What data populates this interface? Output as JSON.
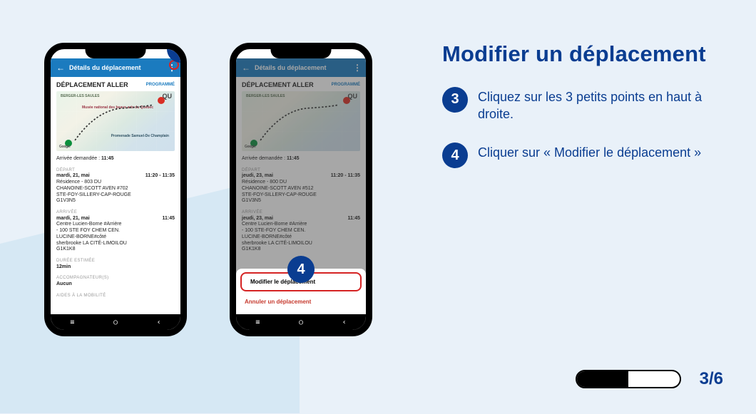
{
  "page": {
    "title": "Modifier un déplacement",
    "instructions": [
      {
        "num": "3",
        "text": "Cliquez sur les 3 petits points en haut à droite."
      },
      {
        "num": "4",
        "text": "Cliquer sur « Modifier le déplacement »"
      }
    ],
    "progress": {
      "percent": 50,
      "page_indicator": "3/6"
    }
  },
  "phone1": {
    "header": {
      "back": "←",
      "title": "Détails du déplacement",
      "menu": "⋮"
    },
    "section": "DÉPLACEMENT ALLER",
    "status": "PROGRAMMÉ",
    "map": {
      "label_ul": "BERGER-LES\nSAULES",
      "label_ur": "QU",
      "poi1": "Musée national des\nbeaux-arts du Québec",
      "poi2": "Promenade\nSamuel-De\nChamplain",
      "google": "Google"
    },
    "arrival_requested_label": "Arrivée demandée :",
    "arrival_requested_value": "11:45",
    "depart": {
      "label": "DÉPART",
      "day": "mardi, 21, mai",
      "time": "11:20 - 11:35",
      "lines": [
        "Résidence - 803 DU",
        "CHANOINE-SCOTT AVEN #702",
        "STE-FOY-SILLERY-CAP-ROUGE",
        "G1V3N5"
      ]
    },
    "arrive": {
      "label": "ARRIVÉE",
      "day": "mardi, 21, mai",
      "time": "11:45",
      "lines": [
        "Centre Lucien-Borne #Arrière",
        "- 100 STE FOY CHEM CEN.",
        "LUCINE-BORNE#côté",
        "sherbrooke LA CITÉ-LIMOILOU",
        "G1K1K8"
      ]
    },
    "duration": {
      "label": "DURÉE ESTIMÉE",
      "value": "12min"
    },
    "companions": {
      "label": "ACCOMPAGNATEUR(S)",
      "value": "Aucun"
    },
    "mobility": {
      "label": "AIDES À LA MOBILITÉ"
    }
  },
  "phone2": {
    "header": {
      "back": "←",
      "title": "Détails du déplacement",
      "menu": "⋮"
    },
    "section": "DÉPLACEMENT ALLER",
    "status": "PROGRAMMÉ",
    "arrival_requested_label": "Arrivée demandée :",
    "arrival_requested_value": "11:45",
    "depart": {
      "label": "DÉPART",
      "day": "jeudi, 23, mai",
      "time": "11:20 - 11:35",
      "lines": [
        "Résidence - 800 DU",
        "CHANOINE-SCOTT AVEN #512",
        "STE-FOY-SILLERY-CAP-ROUGE",
        "G1V3N5"
      ]
    },
    "arrive": {
      "label": "ARRIVÉE",
      "day": "jeudi, 23, mai",
      "time": "11:45",
      "lines": [
        "Centre Lucien-Borne #Arrière",
        "- 100 STE-FOY CHEM CEN.",
        "LUCINE-BORNE#côté",
        "sherbrooke LA CITÉ-LIMOILOU",
        "G1K1K8"
      ]
    },
    "sheet": {
      "modify": "Modifier le déplacement",
      "cancel": "Annuler un déplacement"
    }
  },
  "nav_icons": {
    "menu": "≡",
    "circle": "○",
    "back": "‹"
  }
}
